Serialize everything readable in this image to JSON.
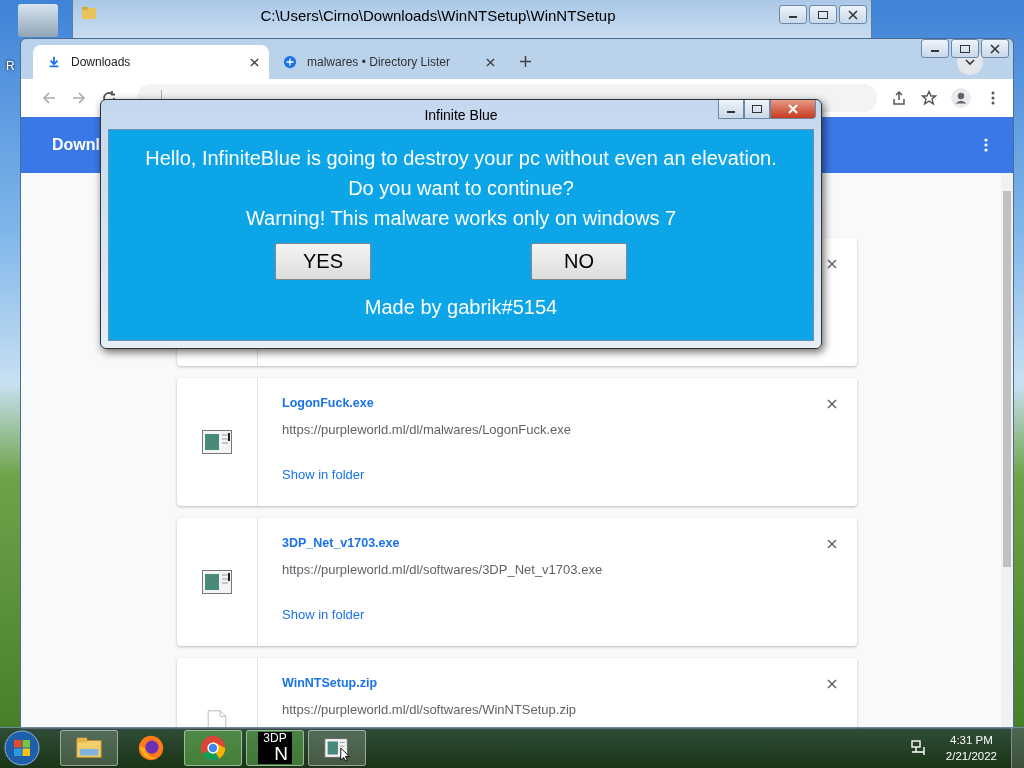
{
  "desktop": {
    "icons": [
      {
        "label": "R"
      }
    ]
  },
  "explorer_window": {
    "title": "C:\\Users\\Cirno\\Downloads\\WinNTSetup\\WinNTSetup"
  },
  "browser": {
    "tabs": [
      {
        "label": "Downloads",
        "kind": "downloads",
        "selected": true
      },
      {
        "label": "malwares • Directory Lister",
        "kind": "site",
        "selected": false
      }
    ],
    "header": {
      "title": "Downl"
    },
    "downloads": [
      {
        "kind": "exe",
        "name": "LogonFuck.exe",
        "url": "https://purpleworld.ml/dl/malwares/LogonFuck.exe",
        "action": "Show in folder"
      },
      {
        "kind": "exe",
        "name": "3DP_Net_v1703.exe",
        "url": "https://purpleworld.ml/dl/softwares/3DP_Net_v1703.exe",
        "action": "Show in folder"
      },
      {
        "kind": "zip",
        "name": "WinNTSetup.zip",
        "url": "https://purpleworld.ml/dl/softwares/WinNTSetup.zip"
      }
    ]
  },
  "dialog": {
    "title": "Infinite Blue",
    "message": [
      "Hello, InfiniteBlue is going to destroy your pc without even an elevation.",
      "Do you want to continue?",
      "Warning! This malware works only on windows 7"
    ],
    "buttons": [
      "YES",
      "NO"
    ],
    "credit": "Made by gabrik#5154"
  },
  "taskbar": {
    "apps": [
      {
        "kind": "explorer",
        "running": true
      },
      {
        "kind": "firefox",
        "running": false
      },
      {
        "kind": "chrome",
        "running": true
      },
      {
        "kind": "tdp",
        "running": true,
        "label_top": "3DP",
        "label_bottom": "N"
      },
      {
        "kind": "app",
        "running": true
      }
    ],
    "clock": {
      "time": "4:31 PM",
      "date": "2/21/2022"
    }
  }
}
